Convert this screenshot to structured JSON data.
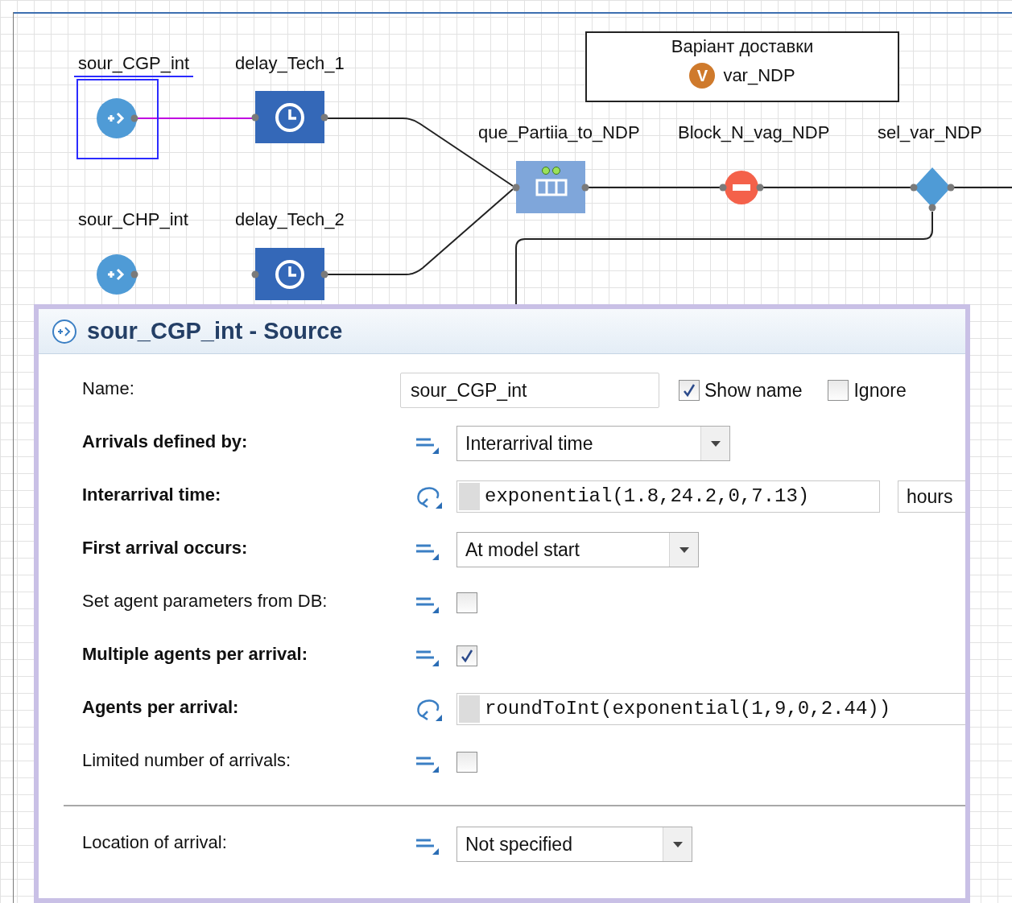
{
  "canvas": {
    "blocks": [
      {
        "kind": "source",
        "label": "sour_CGP_int",
        "selected": true
      },
      {
        "kind": "delay",
        "label": "delay_Tech_1",
        "selected": false
      },
      {
        "kind": "source",
        "label": "sour_CHP_int",
        "selected": false
      },
      {
        "kind": "delay",
        "label": "delay_Tech_2",
        "selected": false
      },
      {
        "kind": "queue",
        "label": "que_Partiia_to_NDP",
        "selected": false
      },
      {
        "kind": "hold",
        "label": "Block_N_vag_NDP",
        "selected": false
      },
      {
        "kind": "select",
        "label": "sel_var_NDP",
        "selected": false
      }
    ],
    "variable_box": {
      "title": "Варіант доставки",
      "variable": {
        "badge": "V",
        "name": "var_NDP"
      }
    }
  },
  "properties": {
    "title": "sour_CGP_int - Source",
    "rows": [
      {
        "kind": "name",
        "label": "Name:",
        "bold": false,
        "value": "sour_CGP_int",
        "options": [
          {
            "label": "Show name",
            "checked": true
          },
          {
            "label": "Ignore",
            "checked": false
          }
        ]
      },
      {
        "kind": "dropdown",
        "label": "Arrivals defined by:",
        "bold": true,
        "dynamic": false,
        "value": "Interarrival time"
      },
      {
        "kind": "code",
        "label": "Interarrival time:",
        "bold": true,
        "dynamic": true,
        "value": "exponential(1.8,24.2,0,7.13)",
        "unit": "hours"
      },
      {
        "kind": "dropdown",
        "label": "First arrival occurs:",
        "bold": true,
        "dynamic": false,
        "value": "At model start"
      },
      {
        "kind": "checkbox",
        "label": "Set agent parameters from DB:",
        "bold": false,
        "dynamic": false,
        "checked": false
      },
      {
        "kind": "checkbox",
        "label": "Multiple agents per arrival:",
        "bold": true,
        "dynamic": false,
        "checked": true
      },
      {
        "kind": "code",
        "label": "Agents per arrival:",
        "bold": true,
        "dynamic": true,
        "value": "roundToInt(exponential(1,9,0,2.44))"
      },
      {
        "kind": "checkbox",
        "label": "Limited number of arrivals:",
        "bold": false,
        "dynamic": false,
        "checked": false
      },
      {
        "kind": "dropdown",
        "label": "Location of arrival:",
        "bold": false,
        "dynamic": false,
        "value": "Not specified",
        "divider_before": true
      }
    ]
  }
}
